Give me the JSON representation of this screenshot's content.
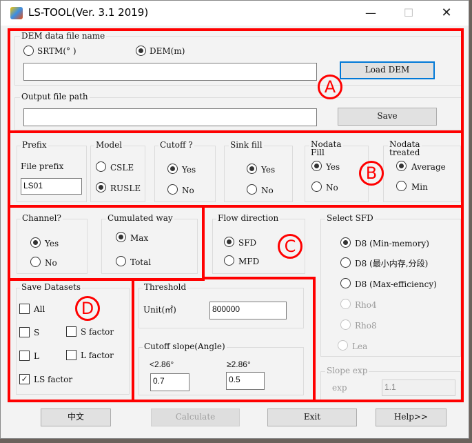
{
  "window": {
    "title": "LS-TOOL(Ver. 3.1 2019)",
    "minimize": "—",
    "maximize": "☐",
    "close": "✕"
  },
  "section_a": {
    "badge": "A",
    "dem_group_label": "DEM data file name",
    "dem_options": [
      {
        "label": "SRTM(° )",
        "selected": false
      },
      {
        "label": "DEM(m)",
        "selected": true
      }
    ],
    "dem_path_value": "",
    "load_dem_label": "Load DEM",
    "output_group_label": "Output file path",
    "output_path_value": "",
    "save_label": "Save"
  },
  "section_b": {
    "badge": "B",
    "prefix": {
      "group_label": "Prefix",
      "field_label": "File prefix",
      "value": "LS01"
    },
    "model": {
      "group_label": "Model",
      "options": [
        {
          "label": "CSLE",
          "selected": false
        },
        {
          "label": "RUSLE",
          "selected": true
        }
      ]
    },
    "cutoff": {
      "group_label": "Cutoff ?",
      "options": [
        {
          "label": "Yes",
          "selected": true
        },
        {
          "label": "No",
          "selected": false
        }
      ]
    },
    "sink_fill": {
      "group_label": "Sink fill",
      "options": [
        {
          "label": "Yes",
          "selected": true
        },
        {
          "label": "No",
          "selected": false
        }
      ]
    },
    "nodata_fill": {
      "group_label_1": "Nodata",
      "group_label_2": "Fill",
      "options": [
        {
          "label": "Yes",
          "selected": true
        },
        {
          "label": "No",
          "selected": false
        }
      ]
    },
    "nodata_treated": {
      "group_label_1": "Nodata",
      "group_label_2": "treated",
      "options": [
        {
          "label": "Average",
          "selected": true
        },
        {
          "label": "Min",
          "selected": false
        }
      ]
    },
    "channel": {
      "group_label": "Channel?",
      "options": [
        {
          "label": "Yes",
          "selected": true
        },
        {
          "label": "No",
          "selected": false
        }
      ]
    },
    "cumulated": {
      "group_label": "Cumulated way",
      "options": [
        {
          "label": "Max",
          "selected": true
        },
        {
          "label": "Total",
          "selected": false
        }
      ]
    }
  },
  "section_c": {
    "badge": "C",
    "flow_direction": {
      "group_label": "Flow direction",
      "options": [
        {
          "label": "SFD",
          "selected": true
        },
        {
          "label": "MFD",
          "selected": false
        }
      ]
    },
    "select_sfd": {
      "group_label": "Select SFD",
      "options": [
        {
          "label": "D8 (Min-memory)",
          "selected": true,
          "enabled": true
        },
        {
          "label": "D8 (最小内存,分段)",
          "selected": false,
          "enabled": true
        },
        {
          "label": "D8 (Max-efficiency)",
          "selected": false,
          "enabled": true
        },
        {
          "label": "Rho4",
          "selected": false,
          "enabled": false
        },
        {
          "label": "Rho8",
          "selected": false,
          "enabled": false
        },
        {
          "label": "Lea",
          "selected": false,
          "enabled": false
        }
      ]
    },
    "slope_exp": {
      "group_label": "Slope exp",
      "field_label": "exp",
      "value": "1.1"
    }
  },
  "section_d": {
    "badge": "D",
    "group_label": "Save Datasets",
    "checkboxes": [
      {
        "label": "All",
        "checked": false
      },
      {
        "label": "S",
        "checked": false
      },
      {
        "label": "S factor",
        "checked": false
      },
      {
        "label": "L",
        "checked": false
      },
      {
        "label": "L factor",
        "checked": false
      },
      {
        "label": "LS factor",
        "checked": true
      }
    ]
  },
  "threshold": {
    "group_label": "Threshold",
    "field_label": "Unit(㎡)",
    "value": "800000"
  },
  "cutoff_slope": {
    "group_label": "Cutoff slope(Angle)",
    "low_label": "<2.86°",
    "low_value": "0.7",
    "high_label": "≥2.86°",
    "high_value": "0.5"
  },
  "footer": {
    "chinese_label": "中文",
    "calculate_label": "Calculate",
    "exit_label": "Exit",
    "help_label": "Help>>"
  },
  "colors": {
    "annotation_red": "#ff0000",
    "focus_blue": "#0078d7"
  }
}
